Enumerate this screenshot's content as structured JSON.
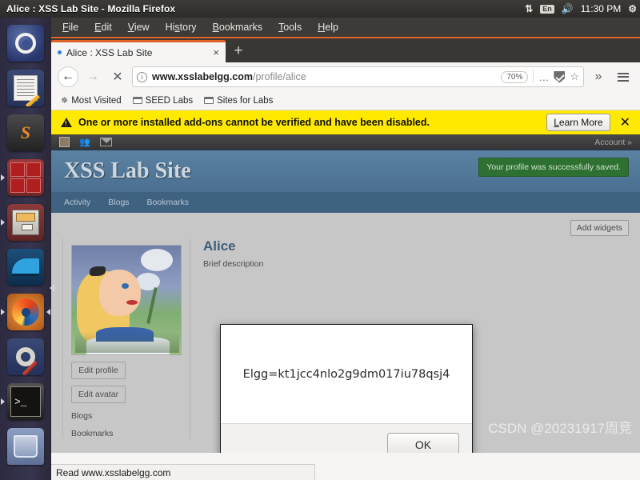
{
  "window": {
    "title": "Alice : XSS Lab Site - Mozilla Firefox",
    "tray": {
      "network_icon": "network-updown-icon",
      "keyboard_layout": "En",
      "volume_icon": "volume-icon",
      "clock": "11:30 PM",
      "power_icon": "power-gear-icon"
    }
  },
  "launcher": {
    "items": [
      {
        "name": "ubuntu-dash",
        "label": "Ubuntu Dash"
      },
      {
        "name": "text-editor",
        "label": "Text Editor"
      },
      {
        "name": "sublime-text",
        "label": "Sublime Text"
      },
      {
        "name": "terminal-grid",
        "label": "Terminals"
      },
      {
        "name": "file-manager",
        "label": "Files"
      },
      {
        "name": "wireshark",
        "label": "Wireshark"
      },
      {
        "name": "firefox",
        "label": "Firefox"
      },
      {
        "name": "system-tools",
        "label": "System Tools"
      },
      {
        "name": "terminal",
        "label": "Terminal"
      },
      {
        "name": "trash",
        "label": "Trash"
      }
    ]
  },
  "menubar": {
    "items": [
      "File",
      "Edit",
      "View",
      "History",
      "Bookmarks",
      "Tools",
      "Help"
    ]
  },
  "tabs": {
    "active": {
      "title": "Alice : XSS Lab Site",
      "close_label": "×"
    },
    "new_tab_label": "+"
  },
  "navbar": {
    "back_label": "←",
    "forward_label": "→",
    "stop_label": "✕",
    "url_domain": "www.xsslabelgg.com",
    "url_path": "/profile/alice",
    "zoom_level": "70%",
    "page_actions_label": "…",
    "overflow_label": "»"
  },
  "bookmarks": {
    "items": [
      {
        "label": "Most Visited",
        "icon": "star-icon"
      },
      {
        "label": "SEED Labs",
        "icon": "folder-icon"
      },
      {
        "label": "Sites for Labs",
        "icon": "folder-icon"
      }
    ]
  },
  "notification": {
    "message": "One or more installed add-ons cannot be verified and have been disabled.",
    "action_label": "Learn More",
    "close_label": "✕"
  },
  "elgg": {
    "topbar": {
      "account_label": "Account »"
    },
    "site_title": "XSS Lab Site",
    "success_message": "Your profile was successfully saved.",
    "nav": [
      "Activity",
      "Blogs",
      "Bookmarks"
    ],
    "add_widgets_label": "Add widgets",
    "profile": {
      "name": "Alice",
      "brief_label": "Brief description",
      "edit_profile_label": "Edit profile",
      "edit_avatar_label": "Edit avatar",
      "links": [
        "Blogs",
        "Bookmarks"
      ]
    }
  },
  "dialog": {
    "message": "Elgg=kt1jcc4nlo2g9dm017iu78qsj4",
    "ok_label": "OK"
  },
  "statusbar": {
    "text": "Read www.xsslabelgg.com"
  },
  "watermark": {
    "text": "CSDN @20231917周竞"
  },
  "colors": {
    "notification_bg": "#ffe900",
    "accent_orange": "#e0632a",
    "success_green": "#2e7031",
    "site_header_blue": "#4a6f90"
  }
}
